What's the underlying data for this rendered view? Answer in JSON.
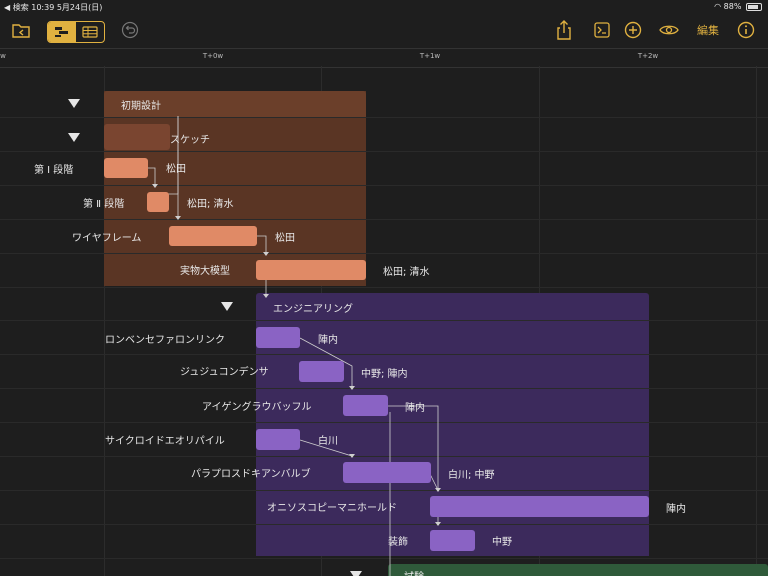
{
  "status": {
    "left": "◀ 検索  10:39  5月24日(日)",
    "right": "88%"
  },
  "toolbar": {
    "edit_label": "編集",
    "icons": [
      "folder-back-icon",
      "gantt-view-icon",
      "table-view-icon",
      "undo-icon",
      "share-icon",
      "console-icon",
      "add-icon",
      "eye-icon",
      "info-icon"
    ]
  },
  "ruler": {
    "ticks": [
      "w",
      "T+0w",
      "T+1w",
      "T+2w"
    ]
  },
  "colors": {
    "design_bg": "#5a3524",
    "design_row": "#6b3f2a",
    "design_bar": "#e08a66",
    "eng_bg": "#3c2a5c",
    "eng_bar": "#8a63c4",
    "test_bg": "#2f5a3a"
  },
  "groups": [
    {
      "name": "初期設計"
    },
    {
      "name": "エンジニアリング"
    },
    {
      "name": "試験"
    }
  ],
  "tasks": [
    {
      "name": "スケッチ",
      "resource": ""
    },
    {
      "name": "第 Ⅰ 段階",
      "resource": "松田"
    },
    {
      "name": "第 Ⅱ 段階",
      "resource": "松田; 清水"
    },
    {
      "name": "ワイヤフレーム",
      "resource": "松田"
    },
    {
      "name": "実物大模型",
      "resource": "松田; 清水"
    },
    {
      "name": "ロンベンセファロンリンク",
      "resource": "陣内"
    },
    {
      "name": "ジュジュコンデンサ",
      "resource": "中野; 陣内"
    },
    {
      "name": "アイゲングラウバッフル",
      "resource": "陣内"
    },
    {
      "name": "サイクロイドエオリパイル",
      "resource": "白川"
    },
    {
      "name": "パラプロスドキアンバルブ",
      "resource": "白川; 中野"
    },
    {
      "name": "オニソスコピーマニホールド",
      "resource": "陣内"
    },
    {
      "name": "装飾",
      "resource": "中野"
    }
  ]
}
